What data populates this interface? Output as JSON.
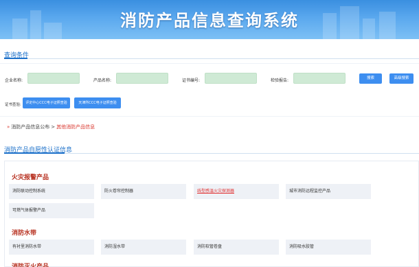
{
  "header": {
    "title": "消防产品信息查询系统"
  },
  "query": {
    "section_title": "查询条件",
    "fields": [
      {
        "label": "企业名称:",
        "value": ""
      },
      {
        "label": "产品名称:",
        "value": ""
      },
      {
        "label": "证书编号:",
        "value": ""
      },
      {
        "label": "检验报告:",
        "value": ""
      }
    ],
    "search_label": "搜索",
    "advanced_label": "高级搜索",
    "cert_label": "证书查验:",
    "cert_buttons": [
      "评定中心CCC电子证照查验",
      "天津所CCC电子证照查验"
    ]
  },
  "breadcrumb": {
    "root": "消防产品信息公布",
    "separator": ">",
    "current": "其他消防产品信息"
  },
  "categories_section": {
    "title": "消防产品自愿性认证信息",
    "groups": [
      {
        "title": "火灾报警产品",
        "items": [
          "消防联动控制系统",
          "防火卷帘控制器",
          "线型感温火灾探测器",
          "城市消防远程监控产品",
          "可燃气体报警产品"
        ]
      },
      {
        "title": "消防水带",
        "items": [
          "有衬里消防水带",
          "消防湿水带",
          "消防软管卷盘",
          "消防吸水胶管"
        ]
      },
      {
        "title": "消防灭火产品"
      }
    ]
  },
  "colors": {
    "accent": "#1a6fc9",
    "button": "#3d8ef0",
    "category_title": "#b7301f",
    "input_bg": "#cfead5"
  }
}
